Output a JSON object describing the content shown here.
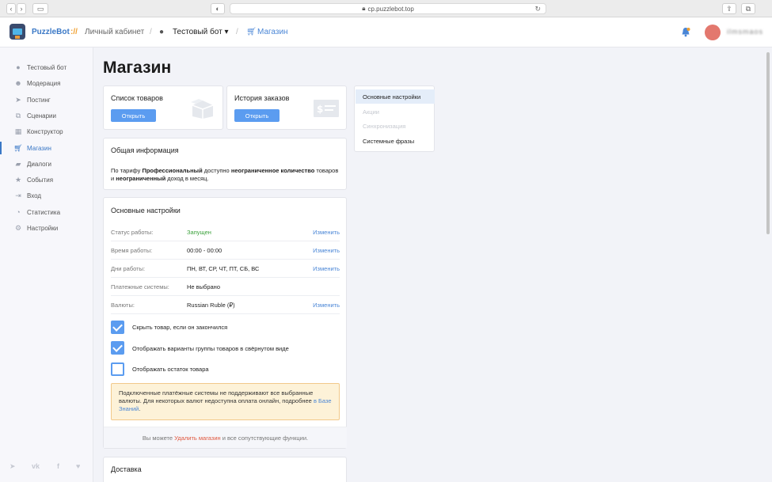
{
  "browser": {
    "url": "cp.puzzlebot.top",
    "lock_icon": "lock-icon"
  },
  "header": {
    "brand": "PuzzleBot",
    "brand_sep": "://",
    "crumb1": "Личный кабинет",
    "crumb2": "Тестовый бот",
    "crumb_sep": "/",
    "crumb3": "Магазин",
    "username": "ilmsmaos"
  },
  "sidebar": {
    "items": [
      {
        "label": "Тестовый бот",
        "icon": "bot-icon"
      },
      {
        "label": "Модерация",
        "icon": "users-icon"
      },
      {
        "label": "Постинг",
        "icon": "paper-plane-icon"
      },
      {
        "label": "Сценарии",
        "icon": "scenario-icon"
      },
      {
        "label": "Конструктор",
        "icon": "grid-icon"
      },
      {
        "label": "Магазин",
        "icon": "cart-icon"
      },
      {
        "label": "Диалоги",
        "icon": "chat-icon"
      },
      {
        "label": "События",
        "icon": "star-icon"
      },
      {
        "label": "Вход",
        "icon": "login-icon"
      },
      {
        "label": "Статистика",
        "icon": "pie-chart-icon"
      },
      {
        "label": "Настройки",
        "icon": "gear-icon"
      }
    ],
    "active_index": 5,
    "social": [
      "telegram-icon",
      "vk-icon",
      "facebook-icon",
      "twitter-icon"
    ]
  },
  "main": {
    "title": "Магазин",
    "products_card": {
      "title": "Список товаров",
      "button": "Открыть"
    },
    "orders_card": {
      "title": "История заказов",
      "button": "Открыть"
    },
    "info": {
      "title": "Общая информация",
      "t1": "По тарифу ",
      "b1": "Профессиональный",
      "t2": " доступно ",
      "b2": "неограниченное количество",
      "t3": " товаров и ",
      "b3": "неограниченный",
      "t4": " доход в месяц."
    },
    "settings": {
      "title": "Основные настройки",
      "rows": [
        {
          "label": "Статус работы:",
          "value": "Запущен",
          "action": "Изменить"
        },
        {
          "label": "Время работы:",
          "value": "00:00 - 00:00",
          "action": "Изменить"
        },
        {
          "label": "Дни работы:",
          "value": "ПН, ВТ, СР, ЧТ, ПТ, СБ, ВС",
          "action": "Изменить"
        },
        {
          "label": "Платежные системы:",
          "value": "Не выбрано",
          "action": ""
        },
        {
          "label": "Валюты:",
          "value": "Russian Ruble (₽)",
          "action": "Изменить"
        }
      ],
      "checkboxes": [
        {
          "label": "Скрыть товар, если он закончился",
          "checked": true
        },
        {
          "label": "Отображать варианты группы товаров в свёрнутом виде",
          "checked": true
        },
        {
          "label": "Отображать остаток товара",
          "checked": false
        }
      ],
      "warning": {
        "text": "Подключенные платёжные системы не поддерживают все выбранные валюты. Для некоторых валют недоступна оплата онлайн, подробнее ",
        "link": "в Базе Знаний",
        "end": "."
      },
      "footer": {
        "t1": "Вы можете ",
        "link": "Удалить магазин",
        "t2": " и все сопутствующие функции."
      }
    },
    "delivery": {
      "title": "Доставка"
    }
  },
  "right_menu": {
    "items": [
      {
        "label": "Основные настройки",
        "state": "active"
      },
      {
        "label": "Акции",
        "state": "disabled"
      },
      {
        "label": "Синхронизация",
        "state": "disabled"
      },
      {
        "label": "Системные фразы",
        "state": "normal"
      }
    ]
  },
  "colors": {
    "accent": "#5b9cf0",
    "link": "#4a86d6",
    "danger": "#e0573e",
    "success": "#3da23d"
  }
}
